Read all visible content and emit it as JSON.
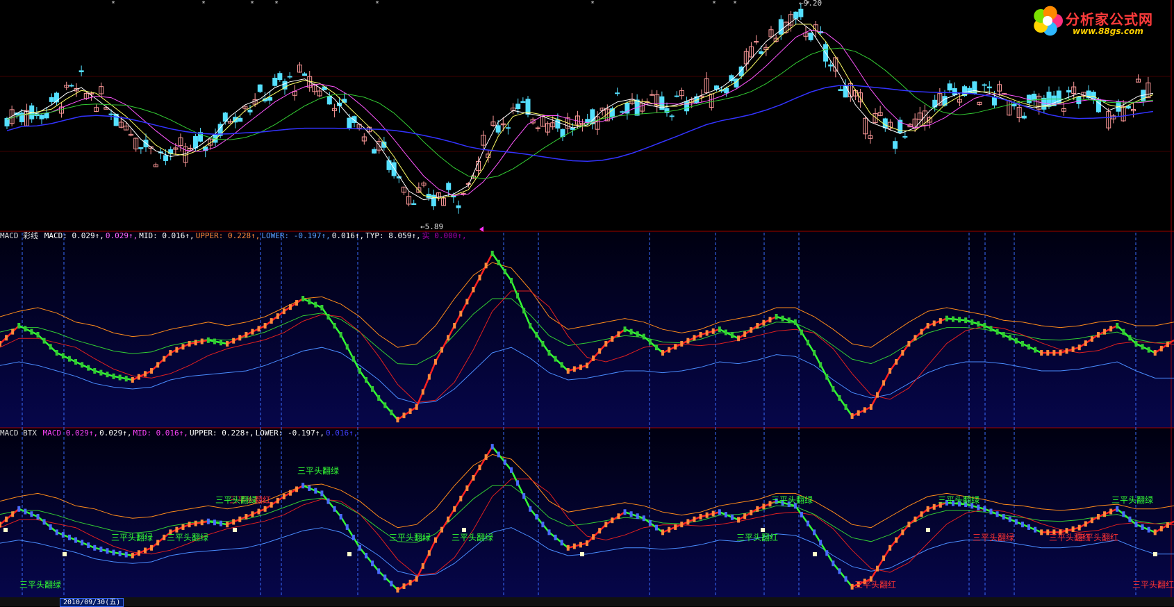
{
  "logo": {
    "title": "分析家公式网",
    "url": "www.88gs.com",
    "flower_colors": [
      "#ff2f7f",
      "#2fb8ff",
      "#ffd400",
      "#7be000",
      "#ff8a00"
    ]
  },
  "price_panel": {
    "high_label": "9.20",
    "low_label": "5.89",
    "ma_colors": [
      "#ffffff",
      "#ffff66",
      "#ff55ff",
      "#33cc33",
      "#3333ff"
    ],
    "up_color": "#ff9a9a",
    "down_color": "#55e0ff"
  },
  "macd_color_panel": {
    "title": "MACD 彩线",
    "fields": [
      {
        "label": "MACD:",
        "value": "0.029",
        "color": "#ffffff"
      },
      {
        "label": "",
        "value": "0.029",
        "color": "#ff66ff"
      },
      {
        "label": "MID:",
        "value": "0.016",
        "color": "#ffffff"
      },
      {
        "label": "UPPER:",
        "value": "0.228",
        "color": "#ff8a3c"
      },
      {
        "label": "LOWER:",
        "value": "-0.197",
        "color": "#5aa0ff"
      },
      {
        "label": "",
        "value": "0.016",
        "color": "#ffffff"
      },
      {
        "label": "TYP:",
        "value": "8.059",
        "color": "#ffffff"
      },
      {
        "label": "实",
        "value": "0.000",
        "color": "#aa00aa"
      }
    ]
  },
  "macd_btx_panel": {
    "title": "MACD BTX",
    "fields": [
      {
        "label": "MACD",
        "value": "0.029",
        "color": "#ff44ff"
      },
      {
        "label": "",
        "value": "0.029",
        "color": "#ffffff"
      },
      {
        "label": "MID:",
        "value": "0.016",
        "color": "#ff44ff"
      },
      {
        "label": "UPPER:",
        "value": "0.228",
        "color": "#ffffff"
      },
      {
        "label": "LOWER:",
        "value": "-0.197",
        "color": "#ffffff"
      },
      {
        "label": "",
        "value": "0.016",
        "color": "#4040ff"
      }
    ],
    "annotations": [
      {
        "text": "三平头翻绿",
        "color": "#33ff33"
      },
      {
        "text": "三平头翻绿",
        "color": "#33ff33"
      },
      {
        "text": "三平头翻绿",
        "color": "#33ff33"
      },
      {
        "text": "三平头翻红",
        "color": "#ff3333"
      },
      {
        "text": "三平头翻绿",
        "color": "#33ff33"
      },
      {
        "text": "三平头翻绿",
        "color": "#33ff33"
      },
      {
        "text": "三平头翻绿",
        "color": "#33ff33"
      },
      {
        "text": "三平头翻绿",
        "color": "#33ff33"
      },
      {
        "text": "三平头翻红",
        "color": "#33ff33"
      },
      {
        "text": "三平头翻绿",
        "color": "#33ff33"
      },
      {
        "text": "三平头翻红",
        "color": "#ff3333"
      },
      {
        "text": "三平头翻绿",
        "color": "#33ff33"
      },
      {
        "text": "三平头翻绿",
        "color": "#ff3333"
      },
      {
        "text": "三平头翻红",
        "color": "#ff3333"
      },
      {
        "text": "三平头翻绿",
        "color": "#33ff33"
      },
      {
        "text": "三平头翻红",
        "color": "#ff3333"
      },
      {
        "text": "三平头翻红",
        "color": "#ff3333"
      }
    ]
  },
  "bottom_bar": {
    "date": "2010/09/30(五)"
  },
  "chart_data": [
    {
      "type": "line",
      "title": "",
      "ylim": [
        5.5,
        9.3
      ],
      "series": [
        {
          "values": [
            7.35,
            7.5,
            7.45,
            7.6,
            7.8,
            7.9,
            7.7,
            7.5,
            7.3,
            7.0,
            6.8,
            6.7,
            6.75,
            6.9,
            7.1,
            7.4,
            7.6,
            7.7,
            7.9,
            8.0,
            8.05,
            7.9,
            7.7,
            7.4,
            7.2,
            6.9,
            6.5,
            6.1,
            5.95,
            6.0,
            6.05,
            6.2,
            6.8,
            7.3,
            7.5,
            7.45,
            7.4,
            7.3,
            7.2,
            7.25,
            7.5,
            7.65,
            7.7,
            7.6,
            7.55,
            7.6,
            7.7,
            7.8,
            7.9,
            8.1,
            8.4,
            8.7,
            8.9,
            9.1,
            8.9,
            8.5,
            8.1,
            7.6,
            7.3,
            7.2,
            7.1,
            7.2,
            7.5,
            7.7,
            7.8,
            7.85,
            7.8,
            7.7,
            7.6,
            7.55,
            7.6,
            7.7,
            7.8,
            7.7,
            7.5,
            7.6,
            7.75,
            7.8
          ]
        }
      ]
    },
    {
      "type": "line",
      "title": "MACD 彩线",
      "ylim": [
        -0.45,
        0.55
      ],
      "series": [
        {
          "name": "MACD",
          "values": [
            0.0,
            0.1,
            0.05,
            -0.05,
            -0.1,
            -0.15,
            -0.18,
            -0.2,
            -0.15,
            -0.05,
            0.0,
            0.02,
            0.0,
            0.05,
            0.1,
            0.18,
            0.25,
            0.2,
            0.05,
            -0.15,
            -0.3,
            -0.42,
            -0.35,
            -0.1,
            0.1,
            0.3,
            0.5,
            0.35,
            0.1,
            -0.05,
            -0.15,
            -0.12,
            0.0,
            0.08,
            0.04,
            -0.05,
            0.0,
            0.05,
            0.08,
            0.03,
            0.1,
            0.15,
            0.12,
            -0.05,
            -0.25,
            -0.4,
            -0.35,
            -0.15,
            0.0,
            0.1,
            0.14,
            0.13,
            0.1,
            0.05,
            0.0,
            -0.05,
            -0.05,
            -0.02,
            0.05,
            0.1,
            0.0,
            -0.05,
            0.02
          ]
        },
        {
          "name": "UPPER",
          "values": [
            0.15,
            0.18,
            0.2,
            0.17,
            0.12,
            0.1,
            0.06,
            0.04,
            0.05,
            0.08,
            0.1,
            0.12,
            0.1,
            0.12,
            0.15,
            0.2,
            0.25,
            0.26,
            0.22,
            0.15,
            0.05,
            -0.02,
            0.0,
            0.1,
            0.25,
            0.38,
            0.45,
            0.42,
            0.3,
            0.15,
            0.08,
            0.1,
            0.12,
            0.14,
            0.12,
            0.08,
            0.06,
            0.08,
            0.12,
            0.14,
            0.16,
            0.2,
            0.2,
            0.15,
            0.08,
            0.0,
            -0.02,
            0.05,
            0.12,
            0.18,
            0.2,
            0.18,
            0.16,
            0.13,
            0.12,
            0.1,
            0.09,
            0.1,
            0.12,
            0.13,
            0.1,
            0.1,
            0.12
          ]
        },
        {
          "name": "LOWER",
          "values": [
            -0.12,
            -0.1,
            -0.12,
            -0.15,
            -0.18,
            -0.22,
            -0.24,
            -0.25,
            -0.24,
            -0.2,
            -0.18,
            -0.17,
            -0.16,
            -0.15,
            -0.12,
            -0.08,
            -0.04,
            -0.02,
            -0.05,
            -0.12,
            -0.2,
            -0.3,
            -0.33,
            -0.32,
            -0.25,
            -0.15,
            -0.05,
            -0.02,
            -0.08,
            -0.16,
            -0.2,
            -0.19,
            -0.17,
            -0.15,
            -0.15,
            -0.16,
            -0.15,
            -0.13,
            -0.1,
            -0.11,
            -0.09,
            -0.06,
            -0.07,
            -0.12,
            -0.2,
            -0.27,
            -0.3,
            -0.28,
            -0.22,
            -0.16,
            -0.12,
            -0.1,
            -0.1,
            -0.11,
            -0.13,
            -0.15,
            -0.15,
            -0.14,
            -0.12,
            -0.1,
            -0.15,
            -0.19,
            -0.19
          ]
        }
      ]
    },
    {
      "type": "line",
      "title": "MACD BTX",
      "ylim": [
        -0.45,
        0.55
      ],
      "series": [
        {
          "name": "MACD",
          "values": [
            0.0,
            0.1,
            0.05,
            -0.05,
            -0.1,
            -0.15,
            -0.18,
            -0.2,
            -0.15,
            -0.05,
            0.0,
            0.02,
            0.0,
            0.05,
            0.1,
            0.18,
            0.25,
            0.2,
            0.05,
            -0.15,
            -0.3,
            -0.42,
            -0.35,
            -0.1,
            0.1,
            0.3,
            0.5,
            0.35,
            0.1,
            -0.05,
            -0.15,
            -0.12,
            0.0,
            0.08,
            0.04,
            -0.05,
            0.0,
            0.05,
            0.08,
            0.03,
            0.1,
            0.15,
            0.12,
            -0.05,
            -0.25,
            -0.4,
            -0.35,
            -0.15,
            0.0,
            0.1,
            0.14,
            0.13,
            0.1,
            0.05,
            0.0,
            -0.05,
            -0.05,
            -0.02,
            0.05,
            0.1,
            0.0,
            -0.05,
            0.02
          ]
        },
        {
          "name": "UPPER",
          "values": [
            0.15,
            0.18,
            0.2,
            0.17,
            0.12,
            0.1,
            0.06,
            0.04,
            0.05,
            0.08,
            0.1,
            0.12,
            0.1,
            0.12,
            0.15,
            0.2,
            0.25,
            0.26,
            0.22,
            0.15,
            0.05,
            -0.02,
            0.0,
            0.1,
            0.25,
            0.38,
            0.45,
            0.42,
            0.3,
            0.15,
            0.08,
            0.1,
            0.12,
            0.14,
            0.12,
            0.08,
            0.06,
            0.08,
            0.12,
            0.14,
            0.16,
            0.2,
            0.2,
            0.15,
            0.08,
            0.0,
            -0.02,
            0.05,
            0.12,
            0.18,
            0.2,
            0.18,
            0.16,
            0.13,
            0.12,
            0.1,
            0.09,
            0.1,
            0.12,
            0.13,
            0.1,
            0.1,
            0.12
          ]
        },
        {
          "name": "LOWER",
          "values": [
            -0.12,
            -0.1,
            -0.12,
            -0.15,
            -0.18,
            -0.22,
            -0.24,
            -0.25,
            -0.24,
            -0.2,
            -0.18,
            -0.17,
            -0.16,
            -0.15,
            -0.12,
            -0.08,
            -0.04,
            -0.02,
            -0.05,
            -0.12,
            -0.2,
            -0.3,
            -0.33,
            -0.32,
            -0.25,
            -0.15,
            -0.05,
            -0.02,
            -0.08,
            -0.16,
            -0.2,
            -0.19,
            -0.17,
            -0.15,
            -0.15,
            -0.16,
            -0.15,
            -0.13,
            -0.1,
            -0.11,
            -0.09,
            -0.06,
            -0.07,
            -0.12,
            -0.2,
            -0.27,
            -0.3,
            -0.28,
            -0.22,
            -0.16,
            -0.12,
            -0.1,
            -0.1,
            -0.11,
            -0.13,
            -0.15,
            -0.15,
            -0.14,
            -0.12,
            -0.1,
            -0.15,
            -0.19,
            -0.19
          ]
        }
      ]
    }
  ]
}
